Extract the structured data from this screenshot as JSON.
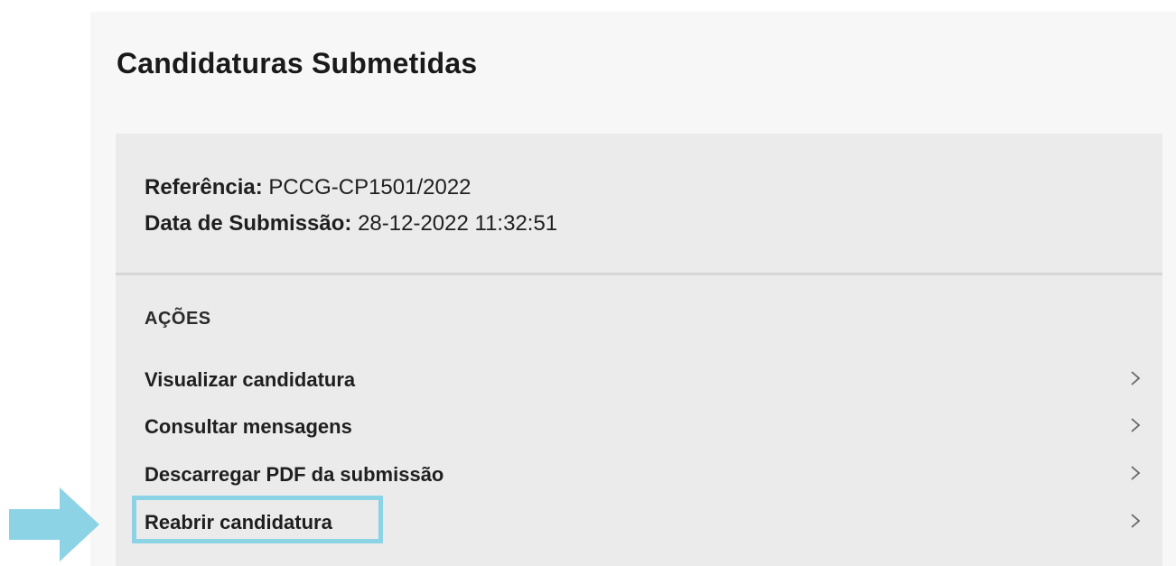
{
  "page": {
    "title": "Candidaturas Submetidas"
  },
  "submission": {
    "reference_label": "Referência:",
    "reference_value": "PCCG-CP1501/2022",
    "date_label": "Data de Submissão:",
    "date_value": "28-12-2022 11:32:51"
  },
  "actions": {
    "heading": "AÇÕES",
    "items": [
      {
        "label": "Visualizar candidatura",
        "icon": "chevron-right-icon"
      },
      {
        "label": "Consultar mensagens",
        "icon": "chevron-right-icon"
      },
      {
        "label": "Descarregar PDF da submissão",
        "icon": "chevron-right-icon"
      },
      {
        "label": "Reabrir candidatura",
        "icon": "chevron-right-icon"
      }
    ]
  },
  "annotation": {
    "highlighted_action": "Reabrir candidatura",
    "icon": "arrow-right-icon",
    "color": "#8dd3e6"
  },
  "colors": {
    "panel_bg": "#f7f7f7",
    "card_bg": "#ebebeb",
    "text": "#1f1f1f"
  }
}
